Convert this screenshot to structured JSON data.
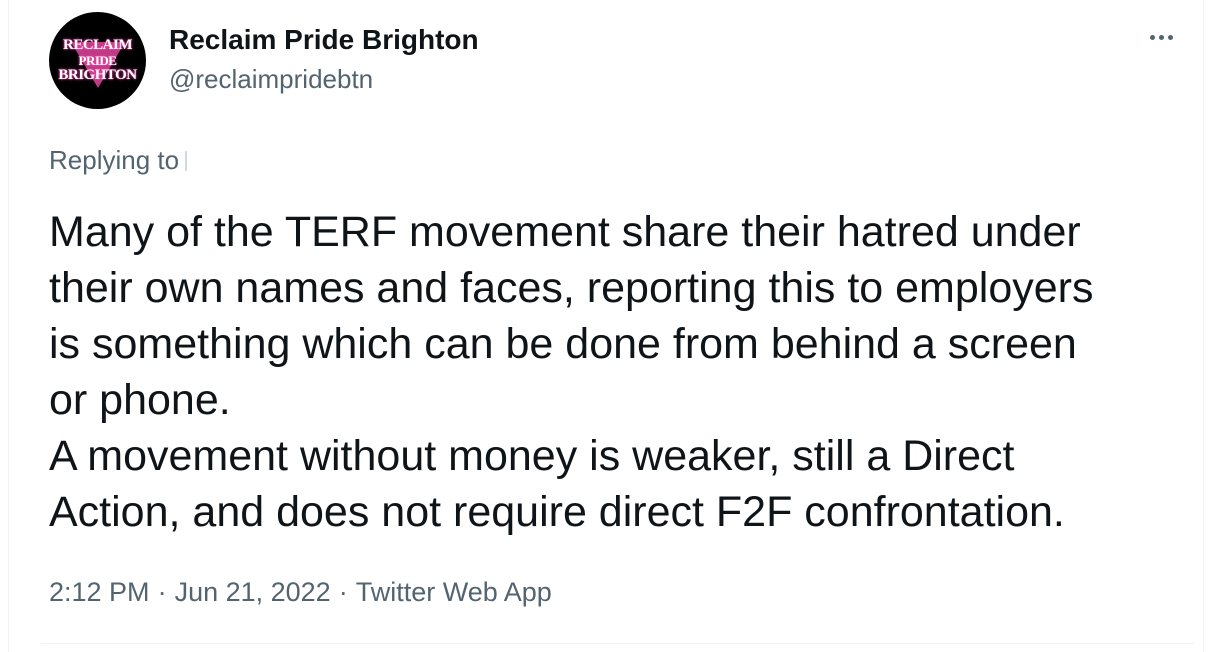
{
  "tweet": {
    "author": {
      "display_name": "Reclaim Pride Brighton",
      "handle": "@reclaimpridebtn",
      "avatar_text": [
        "RECLAIM",
        "PRIDE",
        "BRIGHTON"
      ]
    },
    "replying_to_label": "Replying to",
    "text_lines": [
      "Many of the TERF movement share their hatred under",
      "their own names and faces, reporting this to employers",
      "is something which can be done from behind a screen",
      "or phone.",
      "A movement without money is weaker, still a Direct",
      "Action, and does not require direct F2F confrontation."
    ],
    "time": "2:12 PM",
    "separator": "·",
    "date": "Jun 21, 2022",
    "source": "Twitter Web App",
    "more_icon": "more-horizontal-icon"
  },
  "colors": {
    "text_primary": "#0f1419",
    "text_secondary": "#536471",
    "avatar_bg": "#000000",
    "avatar_accent": "#e0449a"
  }
}
